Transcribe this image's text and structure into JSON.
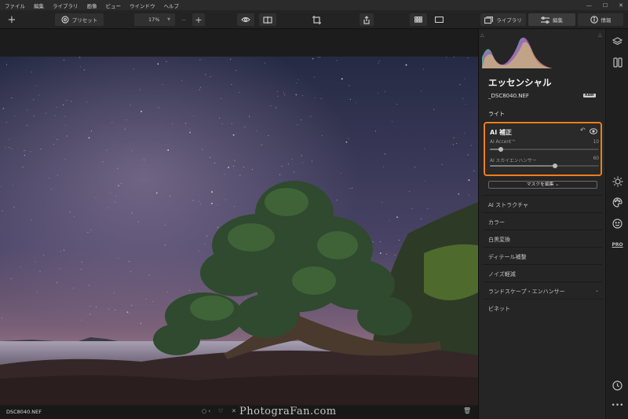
{
  "menu": [
    "ファイル",
    "編集",
    "ライブラリ",
    "画像",
    "ビュー",
    "ウインドウ",
    "ヘルプ"
  ],
  "toolbar": {
    "add_label": "+",
    "presets_label": "プリセット",
    "zoom_value": "17%",
    "zoom_minus": "—",
    "zoom_plus": "+",
    "library_label": "ライブラリ",
    "edit_label": "編集",
    "info_label": "情報"
  },
  "panel": {
    "title": "エッセンシャル",
    "filename": "_DSC8040.NEF",
    "raw_badge": "RAW",
    "light_section": "ライト",
    "ai": {
      "title": "AI 補正",
      "sliders": [
        {
          "label": "AI Accent™",
          "value": "10",
          "level": 0.1
        },
        {
          "label": "AI スカイエンハンサー",
          "value": "60",
          "level": 0.6
        }
      ],
      "mask_button": "マスクを編集 ⌄"
    },
    "sections": [
      "AI ストラクチャ",
      "カラー",
      "白黒変換",
      "ディテール補整",
      "ノイズ軽減",
      "ランドスケープ・エンハンサー",
      "ビネット"
    ]
  },
  "bottom": {
    "filename": "DSC8040.NEF",
    "watermark": "PhotograFan.com"
  },
  "colors": {
    "accent": "#f07d1a",
    "panel_bg": "#252525"
  }
}
